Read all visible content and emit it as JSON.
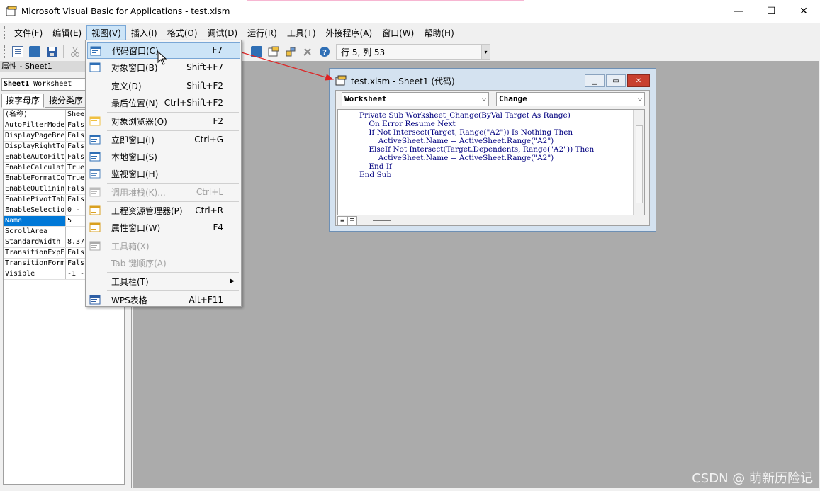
{
  "window": {
    "title": "Microsoft Visual Basic for Applications - test.xlsm",
    "minimize_glyph": "—",
    "maximize_glyph": "☐",
    "close_glyph": "✕"
  },
  "menubar": {
    "items": [
      "文件(F)",
      "编辑(E)",
      "视图(V)",
      "插入(I)",
      "格式(O)",
      "调试(D)",
      "运行(R)",
      "工具(T)",
      "外接程序(A)",
      "窗口(W)",
      "帮助(H)"
    ],
    "active": "视图(V)"
  },
  "toolbar": {
    "position_text": "行 5, 列 53"
  },
  "properties": {
    "header": "属性 - Sheet1",
    "object_name": "Sheet1",
    "object_type": "Worksheet",
    "tabs": [
      "按字母序",
      "按分类序"
    ],
    "rows": [
      {
        "name": "(名称)",
        "value": "Shee"
      },
      {
        "name": "AutoFilterMode",
        "value": "Fals"
      },
      {
        "name": "DisplayPageBre",
        "value": "Fals"
      },
      {
        "name": "DisplayRightTo",
        "value": "Fals"
      },
      {
        "name": "EnableAutoFilt",
        "value": "Fals"
      },
      {
        "name": "EnableCalculat",
        "value": "True"
      },
      {
        "name": "EnableFormatCo",
        "value": "True"
      },
      {
        "name": "EnableOutlinin",
        "value": "Fals"
      },
      {
        "name": "EnablePivotTab",
        "value": "Fals"
      },
      {
        "name": "EnableSelectio",
        "value": "0 -"
      },
      {
        "name": "Name",
        "value": "5"
      },
      {
        "name": "ScrollArea",
        "value": ""
      },
      {
        "name": "StandardWidth",
        "value": "8.37"
      },
      {
        "name": "TransitionExpE",
        "value": "Fals"
      },
      {
        "name": "TransitionForm",
        "value": "Fals"
      },
      {
        "name": "Visible",
        "value": "-1 -"
      }
    ],
    "selected_row": "Name"
  },
  "view_menu": {
    "items": [
      {
        "label": "代码窗口(C)",
        "shortcut": "F7",
        "disabled": false,
        "highlighted": true
      },
      {
        "label": "对象窗口(B)",
        "shortcut": "Shift+F7",
        "disabled": false
      },
      {
        "label": "定义(D)",
        "shortcut": "Shift+F2",
        "disabled": false
      },
      {
        "label": "最后位置(N)",
        "shortcut": "Ctrl+Shift+F2",
        "disabled": false
      },
      {
        "label": "对象浏览器(O)",
        "shortcut": "F2",
        "disabled": false
      },
      {
        "label": "立即窗口(I)",
        "shortcut": "Ctrl+G",
        "disabled": false
      },
      {
        "label": "本地窗口(S)",
        "shortcut": "",
        "disabled": false
      },
      {
        "label": "监视窗口(H)",
        "shortcut": "",
        "disabled": false
      },
      {
        "label": "调用堆栈(K)...",
        "shortcut": "Ctrl+L",
        "disabled": true
      },
      {
        "label": "工程资源管理器(P)",
        "shortcut": "Ctrl+R",
        "disabled": false
      },
      {
        "label": "属性窗口(W)",
        "shortcut": "F4",
        "disabled": false
      },
      {
        "label": "工具箱(X)",
        "shortcut": "",
        "disabled": true
      },
      {
        "label": "Tab 键顺序(A)",
        "shortcut": "",
        "disabled": true
      },
      {
        "label": "工具栏(T)",
        "shortcut": "",
        "disabled": false,
        "submenu": true
      },
      {
        "label": "WPS表格",
        "shortcut": "Alt+F11",
        "disabled": false
      }
    ]
  },
  "code_window": {
    "title": "test.xlsm - Sheet1 (代码)",
    "object_combo": "Worksheet",
    "proc_combo": "Change",
    "code_lines": [
      "Private Sub Worksheet_Change(ByVal Target As Range)",
      "    On Error Resume Next",
      "    If Not Intersect(Target, Range(\"A2\")) Is Nothing Then",
      "        ActiveSheet.Name = ActiveSheet.Range(\"A2\")",
      "    ElseIf Not Intersect(Target.Dependents, Range(\"A2\")) Then",
      "        ActiveSheet.Name = ActiveSheet.Range(\"A2\")",
      "    End If",
      "End Sub"
    ]
  },
  "watermark": "CSDN @ 萌新历险记",
  "colors": {
    "highlight": "#cce4f7",
    "mdi_background": "#ababab",
    "arrow": "#e02020",
    "keyword": "#00007f"
  }
}
